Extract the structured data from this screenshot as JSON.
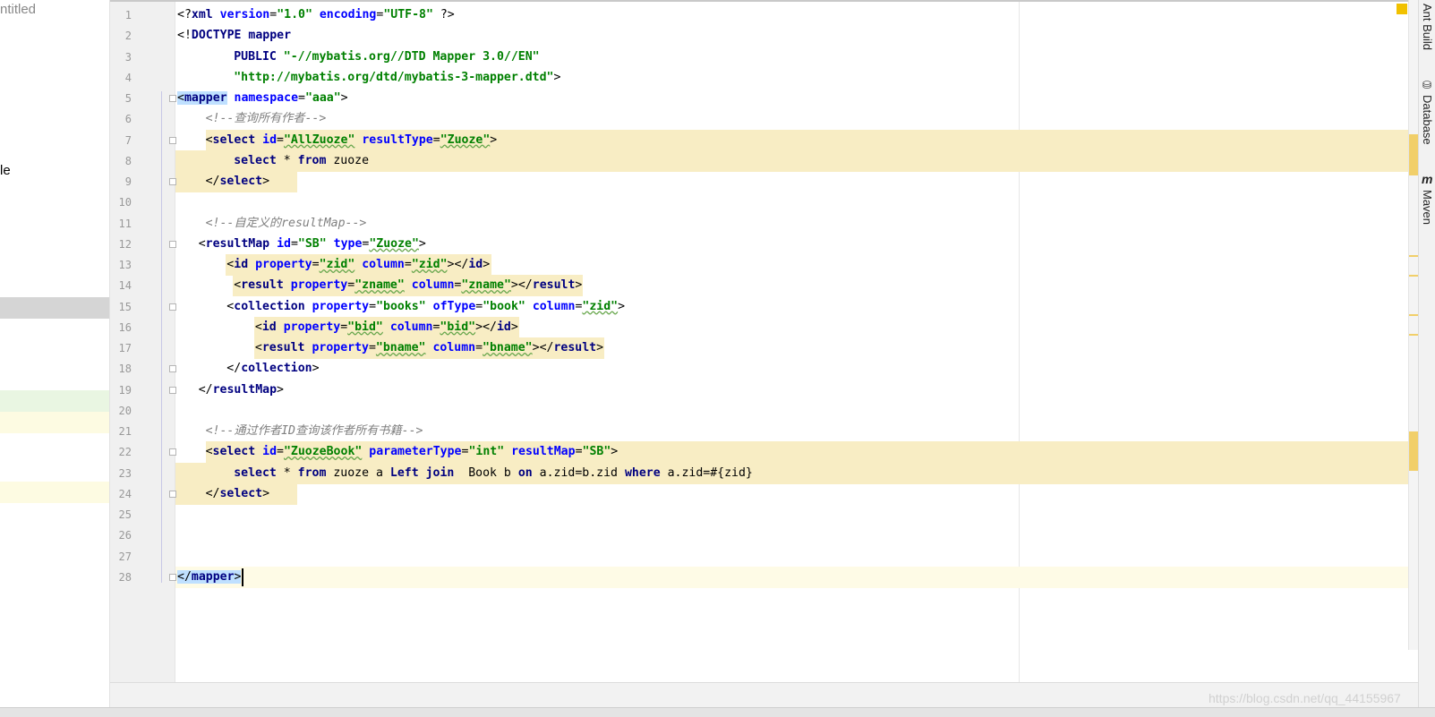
{
  "project": {
    "title_fragment": "ntitled",
    "item_fragment": "le"
  },
  "lines": [
    {
      "n": "1",
      "ind": 0,
      "tokens": [
        [
          "br",
          "<?"
        ],
        [
          "tag",
          "xml "
        ],
        [
          "at",
          "version"
        ],
        [
          "br",
          "="
        ],
        [
          "str",
          "\"1.0\""
        ],
        [
          "br",
          " "
        ],
        [
          "at",
          "encoding"
        ],
        [
          "br",
          "="
        ],
        [
          "str",
          "\"UTF-8\""
        ],
        [
          "br",
          " ?>"
        ]
      ]
    },
    {
      "n": "2",
      "ind": 0,
      "tokens": [
        [
          "br",
          "<!"
        ],
        [
          "tag",
          "DOCTYPE "
        ],
        [
          "tag",
          "mapper"
        ]
      ]
    },
    {
      "n": "3",
      "ind": 8,
      "tokens": [
        [
          "kw",
          "PUBLIC "
        ],
        [
          "str",
          "\"-//mybatis.org//DTD Mapper 3.0//EN\""
        ]
      ]
    },
    {
      "n": "4",
      "ind": 8,
      "tokens": [
        [
          "str",
          "\"http://mybatis.org/dtd/mybatis-3-mapper.dtd\""
        ],
        [
          "br",
          ">"
        ]
      ]
    },
    {
      "n": "5",
      "ind": 0,
      "tokens": [
        [
          "br",
          "<"
        ],
        [
          "tag",
          "mapper"
        ],
        [
          "br",
          " "
        ],
        [
          "at",
          "namespace"
        ],
        [
          "br",
          "="
        ],
        [
          "str",
          "\"aaa\""
        ],
        [
          "br",
          ">"
        ]
      ]
    },
    {
      "n": "6",
      "ind": 4,
      "tokens": [
        [
          "com",
          "<!--查询所有作者-->"
        ]
      ]
    },
    {
      "n": "7",
      "ind": 4,
      "tokens": [
        [
          "br",
          "<"
        ],
        [
          "tag",
          "select"
        ],
        [
          "br",
          " "
        ],
        [
          "at",
          "id"
        ],
        [
          "br",
          "="
        ],
        [
          "str",
          "\"AllZuoze\""
        ],
        [
          "br",
          " "
        ],
        [
          "at",
          "resultType"
        ],
        [
          "br",
          "="
        ],
        [
          "str",
          "\"Zuoze\""
        ],
        [
          "br",
          ">"
        ]
      ]
    },
    {
      "n": "8",
      "ind": 8,
      "tokens": [
        [
          "kw",
          "select"
        ],
        [
          "id",
          " * "
        ],
        [
          "kw",
          "from"
        ],
        [
          "id",
          " zuoze"
        ]
      ]
    },
    {
      "n": "9",
      "ind": 4,
      "tokens": [
        [
          "br",
          "</"
        ],
        [
          "tag",
          "select"
        ],
        [
          "br",
          ">"
        ]
      ]
    },
    {
      "n": "10",
      "ind": 0,
      "tokens": []
    },
    {
      "n": "11",
      "ind": 4,
      "tokens": [
        [
          "com",
          "<!--自定义的resultMap-->"
        ]
      ]
    },
    {
      "n": "12",
      "ind": 3,
      "tokens": [
        [
          "br",
          "<"
        ],
        [
          "tag",
          "resultMap"
        ],
        [
          "br",
          " "
        ],
        [
          "at",
          "id"
        ],
        [
          "br",
          "="
        ],
        [
          "str",
          "\"SB\""
        ],
        [
          "br",
          " "
        ],
        [
          "at",
          "type"
        ],
        [
          "br",
          "="
        ],
        [
          "str",
          "\"Zuoze\""
        ],
        [
          "br",
          ">"
        ]
      ]
    },
    {
      "n": "13",
      "ind": 7,
      "tokens": [
        [
          "br",
          "<"
        ],
        [
          "tag",
          "id"
        ],
        [
          "br",
          " "
        ],
        [
          "at",
          "property"
        ],
        [
          "br",
          "="
        ],
        [
          "str",
          "\"zid\""
        ],
        [
          "br",
          " "
        ],
        [
          "at",
          "column"
        ],
        [
          "br",
          "="
        ],
        [
          "str",
          "\"zid\""
        ],
        [
          "br",
          "></"
        ],
        [
          "tag",
          "id"
        ],
        [
          "br",
          ">"
        ]
      ]
    },
    {
      "n": "14",
      "ind": 8,
      "tokens": [
        [
          "br",
          "<"
        ],
        [
          "tag",
          "result"
        ],
        [
          "br",
          " "
        ],
        [
          "at",
          "property"
        ],
        [
          "br",
          "="
        ],
        [
          "str",
          "\"zname\""
        ],
        [
          "br",
          " "
        ],
        [
          "at",
          "column"
        ],
        [
          "br",
          "="
        ],
        [
          "str",
          "\"zname\""
        ],
        [
          "br",
          "></"
        ],
        [
          "tag",
          "result"
        ],
        [
          "br",
          ">"
        ]
      ]
    },
    {
      "n": "15",
      "ind": 7,
      "tokens": [
        [
          "br",
          "<"
        ],
        [
          "tag",
          "collection"
        ],
        [
          "br",
          " "
        ],
        [
          "at",
          "property"
        ],
        [
          "br",
          "="
        ],
        [
          "str",
          "\"books\""
        ],
        [
          "br",
          " "
        ],
        [
          "at",
          "ofType"
        ],
        [
          "br",
          "="
        ],
        [
          "str",
          "\"book\""
        ],
        [
          "br",
          " "
        ],
        [
          "at",
          "column"
        ],
        [
          "br",
          "="
        ],
        [
          "str",
          "\"zid\""
        ],
        [
          "br",
          ">"
        ]
      ]
    },
    {
      "n": "16",
      "ind": 11,
      "tokens": [
        [
          "br",
          "<"
        ],
        [
          "tag",
          "id"
        ],
        [
          "br",
          " "
        ],
        [
          "at",
          "property"
        ],
        [
          "br",
          "="
        ],
        [
          "str",
          "\"bid\""
        ],
        [
          "br",
          " "
        ],
        [
          "at",
          "column"
        ],
        [
          "br",
          "="
        ],
        [
          "str",
          "\"bid\""
        ],
        [
          "br",
          "></"
        ],
        [
          "tag",
          "id"
        ],
        [
          "br",
          ">"
        ]
      ]
    },
    {
      "n": "17",
      "ind": 11,
      "tokens": [
        [
          "br",
          "<"
        ],
        [
          "tag",
          "result"
        ],
        [
          "br",
          " "
        ],
        [
          "at",
          "property"
        ],
        [
          "br",
          "="
        ],
        [
          "str",
          "\"bname\""
        ],
        [
          "br",
          " "
        ],
        [
          "at",
          "column"
        ],
        [
          "br",
          "="
        ],
        [
          "str",
          "\"bname\""
        ],
        [
          "br",
          "></"
        ],
        [
          "tag",
          "result"
        ],
        [
          "br",
          ">"
        ]
      ]
    },
    {
      "n": "18",
      "ind": 7,
      "tokens": [
        [
          "br",
          "</"
        ],
        [
          "tag",
          "collection"
        ],
        [
          "br",
          ">"
        ]
      ]
    },
    {
      "n": "19",
      "ind": 3,
      "tokens": [
        [
          "br",
          "</"
        ],
        [
          "tag",
          "resultMap"
        ],
        [
          "br",
          ">"
        ]
      ]
    },
    {
      "n": "20",
      "ind": 0,
      "tokens": []
    },
    {
      "n": "21",
      "ind": 4,
      "tokens": [
        [
          "com",
          "<!--通过作者ID查询该作者所有书籍-->"
        ]
      ]
    },
    {
      "n": "22",
      "ind": 4,
      "tokens": [
        [
          "br",
          "<"
        ],
        [
          "tag",
          "select"
        ],
        [
          "br",
          " "
        ],
        [
          "at",
          "id"
        ],
        [
          "br",
          "="
        ],
        [
          "str",
          "\"ZuozeBook\""
        ],
        [
          "br",
          " "
        ],
        [
          "at",
          "parameterType"
        ],
        [
          "br",
          "="
        ],
        [
          "str",
          "\"int\""
        ],
        [
          "br",
          " "
        ],
        [
          "at",
          "resultMap"
        ],
        [
          "br",
          "="
        ],
        [
          "str",
          "\"SB\""
        ],
        [
          "br",
          ">"
        ]
      ]
    },
    {
      "n": "23",
      "ind": 8,
      "tokens": [
        [
          "kw",
          "select"
        ],
        [
          "id",
          " * "
        ],
        [
          "kw",
          "from"
        ],
        [
          "id",
          " zuoze a "
        ],
        [
          "kw",
          "Left join"
        ],
        [
          "id",
          "  Book b "
        ],
        [
          "kw",
          "on"
        ],
        [
          "id",
          " a.zid=b.zid "
        ],
        [
          "kw",
          "where"
        ],
        [
          "id",
          " a.zid=#{zid}"
        ]
      ]
    },
    {
      "n": "24",
      "ind": 4,
      "tokens": [
        [
          "br",
          "</"
        ],
        [
          "tag",
          "select"
        ],
        [
          "br",
          ">"
        ]
      ]
    },
    {
      "n": "25",
      "ind": 0,
      "tokens": []
    },
    {
      "n": "26",
      "ind": 0,
      "tokens": []
    },
    {
      "n": "27",
      "ind": 0,
      "tokens": []
    },
    {
      "n": "28",
      "ind": 0,
      "tokens": [
        [
          "br",
          "</"
        ],
        [
          "tag",
          "mapper"
        ],
        [
          "br",
          ">"
        ]
      ]
    }
  ],
  "right_tabs": [
    "Ant Build",
    "Database",
    "Maven"
  ],
  "watermark": "https://blog.csdn.net/qq_44155967",
  "colors": {
    "block_highlight": "#f8edc4",
    "tag_highlight": "#bfe0ff",
    "current_line": "#fefbe6"
  }
}
